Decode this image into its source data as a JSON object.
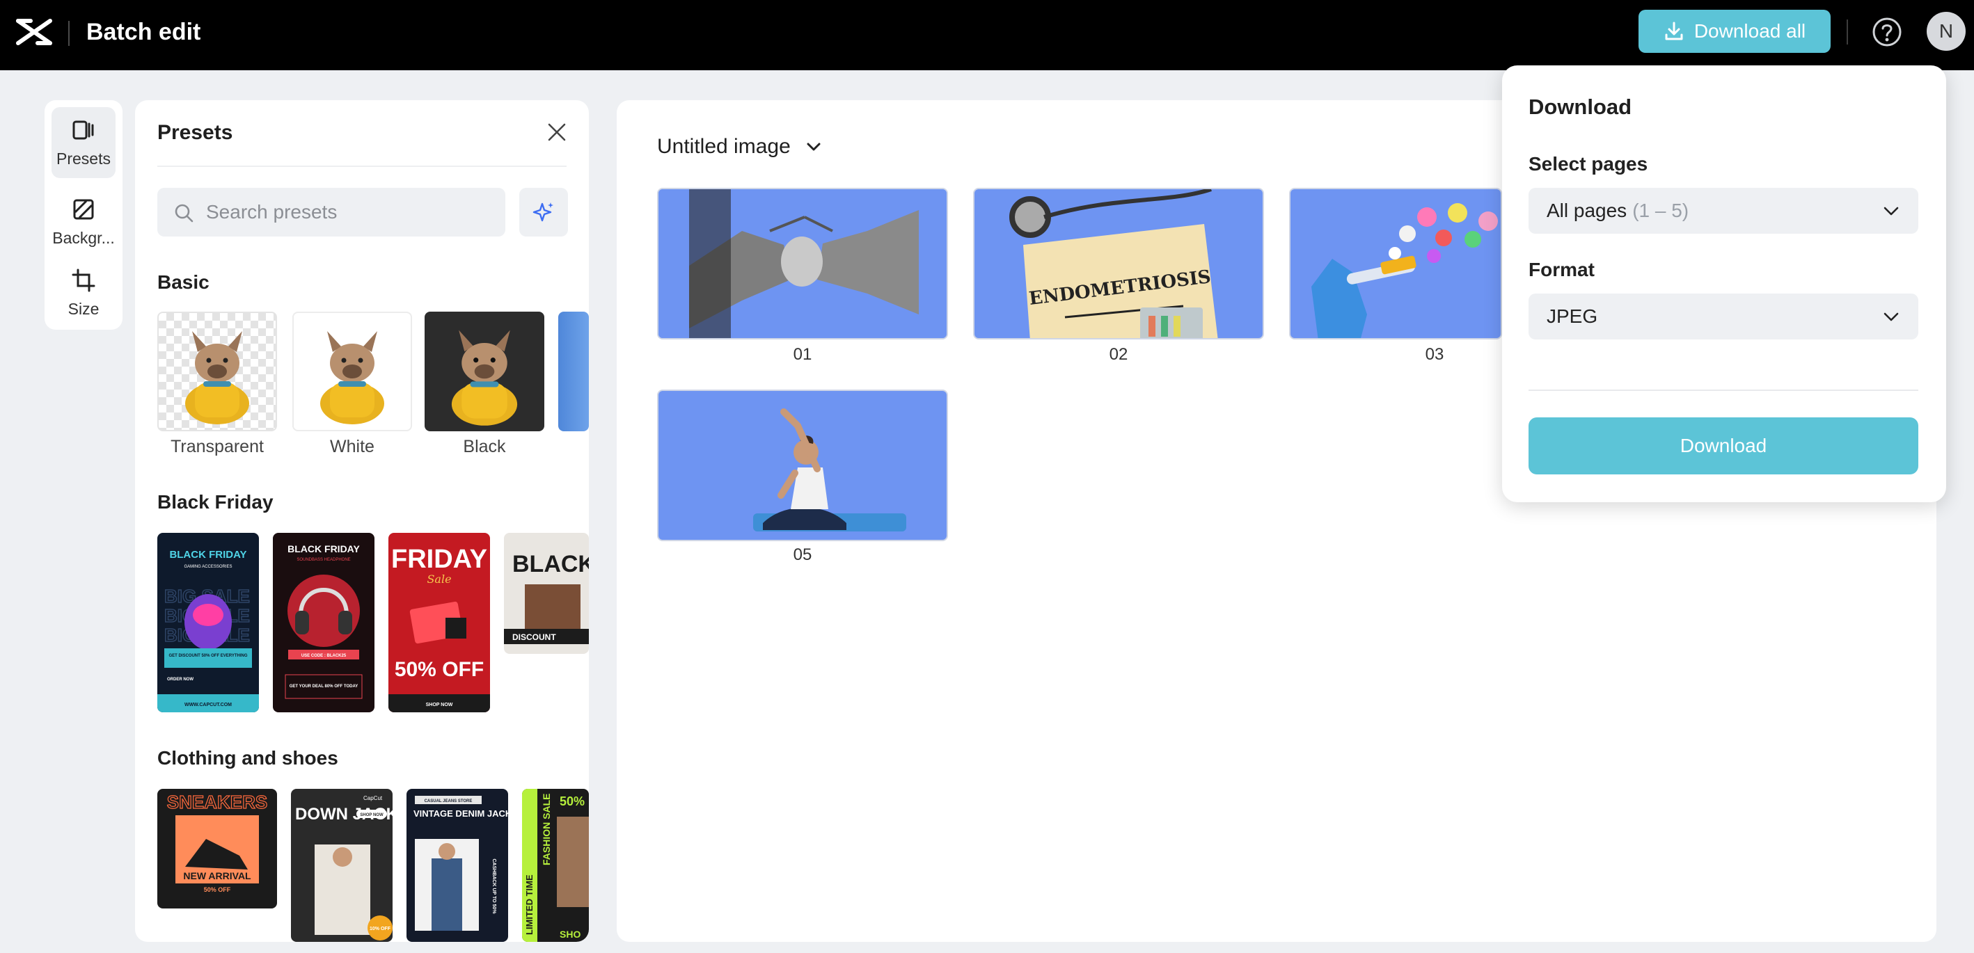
{
  "header": {
    "app_title": "Batch edit",
    "download_all_label": "Download all",
    "avatar_initial": "N",
    "icons": [
      "capcut-logo-icon",
      "download-icon",
      "help-icon"
    ]
  },
  "tool_rail": {
    "items": [
      {
        "label": "Presets",
        "icon": "presets-icon",
        "active": true
      },
      {
        "label": "Backgr...",
        "icon": "background-icon",
        "active": false
      },
      {
        "label": "Size",
        "icon": "crop-icon",
        "active": false
      }
    ]
  },
  "presets_panel": {
    "title": "Presets",
    "search_placeholder": "Search presets",
    "sections": {
      "basic": {
        "title": "Basic",
        "items": [
          {
            "label": "Transparent"
          },
          {
            "label": "White"
          },
          {
            "label": "Black"
          }
        ]
      },
      "black_friday": {
        "title": "Black Friday",
        "thumbs": [
          {
            "headline": "BLACK FRIDAY",
            "sub": "GAMING ACCESSORIES",
            "promo": "GET DISCOUNT 50% OFF EVERYTHING",
            "cta": "ORDER NOW",
            "footer": "WWW.CAPCUT.COM"
          },
          {
            "headline": "BLACK FRIDAY",
            "sub": "SOUNDBASS HEADPHONE",
            "promo": "USE CODE : BLACK25",
            "cta": "GET YOUR DEAL 80% OFF TODAY"
          },
          {
            "headline": "FRIDAY",
            "sub": "Sale",
            "promo": "50% OFF",
            "cta": "SHOP NOW"
          },
          {
            "headline": "BLACK F",
            "cta": "DISCOUNT"
          }
        ]
      },
      "clothing": {
        "title": "Clothing and shoes",
        "thumbs": [
          {
            "headline": "NEW ARRIVAL",
            "sub": "50% OFF",
            "bg": "SNEAKERS"
          },
          {
            "headline": "DOWN JACKET",
            "sub": "SHOP NOW",
            "brand": "CapCut",
            "promo": "10% OFF"
          },
          {
            "headline": "VINTAGE DENIM JACKET",
            "sub": "CASUAL JEANS STORE",
            "promo": "CASHBACK UP TO 50%"
          },
          {
            "headline": "FASHION SALE",
            "sub": "LIMITED TIME",
            "promo": "50%",
            "cta": "SHO"
          }
        ]
      }
    }
  },
  "canvas": {
    "doc_title": "Untitled image",
    "pages": [
      {
        "number": "01"
      },
      {
        "number": "02",
        "label_text": "ENDOMETRIOSIS"
      },
      {
        "number": "03"
      },
      {
        "number": "05"
      }
    ]
  },
  "download_panel": {
    "title": "Download",
    "select_pages_label": "Select pages",
    "select_pages_value": "All pages",
    "select_pages_range": "(1 – 5)",
    "format_label": "Format",
    "format_value": "JPEG",
    "button_label": "Download"
  },
  "colors": {
    "accent": "#5cc4d7",
    "page_bg": "#6e94f2",
    "topbar": "#000000",
    "app_bg": "#eef0f3"
  }
}
